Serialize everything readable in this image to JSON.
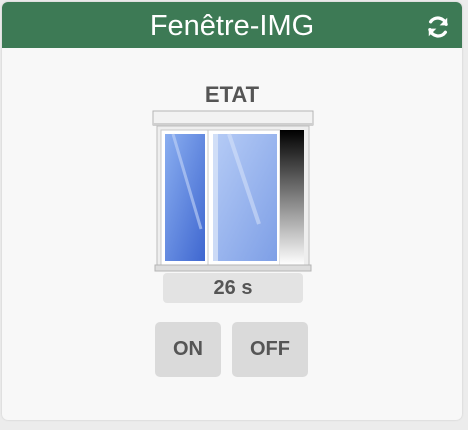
{
  "widget": {
    "title": "Fenêtre-IMG",
    "header_color": "#3d7a55",
    "refresh_icon": "refresh-icon",
    "state_label": "ETAT",
    "window_icon": "sliding-window-icon",
    "timer_text": "26 s",
    "buttons": {
      "on_label": "ON",
      "off_label": "OFF"
    }
  }
}
